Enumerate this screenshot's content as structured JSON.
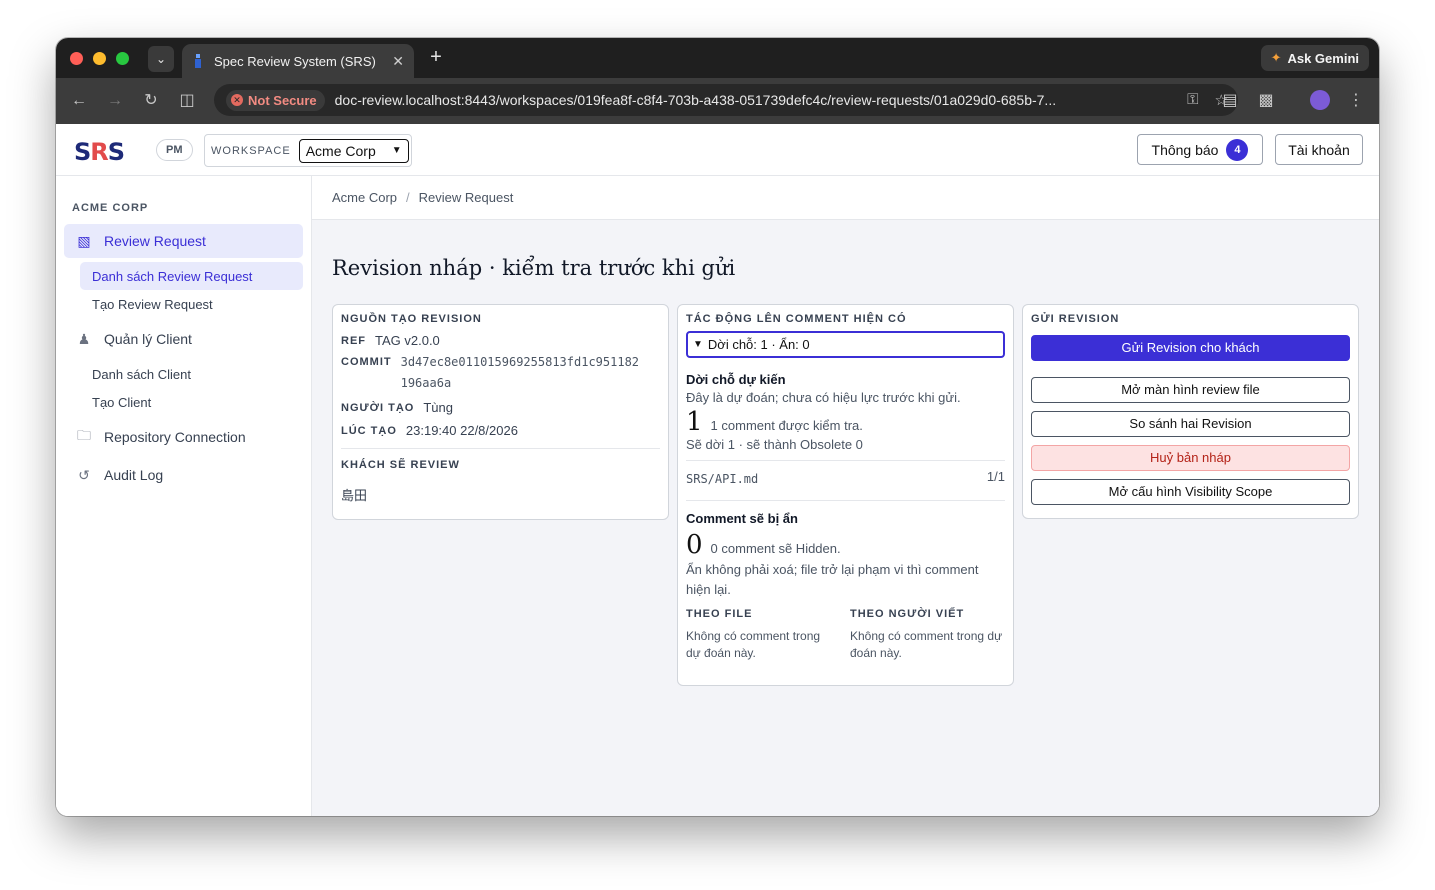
{
  "browser": {
    "tab_title": "Spec Review System (SRS)",
    "not_secure": "Not Secure",
    "url": "doc-review.localhost:8443/workspaces/019fea8f-c8f4-703b-a438-051739defc4c/review-requests/01a029d0-685b-7...",
    "ask_gemini": "Ask Gemini"
  },
  "header": {
    "logo": "SRS",
    "role": "PM",
    "workspace_label": "WORKSPACE",
    "workspace_value": "Acme Corp",
    "notifications_label": "Thông báo",
    "notifications_count": "4",
    "account_label": "Tài khoản"
  },
  "sidebar": {
    "org": "ACME CORP",
    "review_request": "Review Request",
    "review_list": "Danh sách Review Request",
    "review_create": "Tạo Review Request",
    "client_manage": "Quản lý Client",
    "client_list": "Danh sách Client",
    "client_create": "Tạo Client",
    "repo": "Repository Connection",
    "audit": "Audit Log"
  },
  "breadcrumb": {
    "org": "Acme Corp",
    "sep": "/",
    "page": "Review Request"
  },
  "page_title": "Revision nháp · kiểm tra trước khi gửi",
  "source_card": {
    "title": "NGUỒN TẠO REVISION",
    "ref_label": "REF",
    "ref_value": "TAG v2.0.0",
    "commit_label": "COMMIT",
    "commit_line1": "3d47ec8e011015969255813fd1c951182",
    "commit_line2": "196aa6a",
    "creator_label": "NGƯỜI TẠO",
    "creator_value": "Tùng",
    "created_label": "LÚC TẠO",
    "created_value": "23:19:40 22/8/2026",
    "reviewer_title": "KHÁCH SẼ REVIEW",
    "reviewer_value": "島田"
  },
  "impact_card": {
    "title": "TÁC ĐỘNG LÊN COMMENT HIỆN CÓ",
    "summary": "Dời chỗ: 1 · Ẩn: 0",
    "move_title": "Dời chỗ dự kiến",
    "move_note": "Đây là dự đoán; chưa có hiệu lực trước khi gửi.",
    "move_count": "1",
    "move_count_text": "1 comment được kiểm tra.",
    "move_detail": "Sẽ dời 1 · sẽ thành Obsolete 0",
    "file_name": "SRS/API.md",
    "file_ratio": "1/1",
    "hidden_title": "Comment sẽ bị ẩn",
    "hidden_count": "0",
    "hidden_count_text": "0 comment sẽ Hidden.",
    "hidden_note": "Ẩn không phải xoá; file trở lại phạm vi thì comment hiện lại.",
    "by_file_label": "THEO FILE",
    "by_file_text": "Không có comment trong dự đoán này.",
    "by_author_label": "THEO NGƯỜI VIẾT",
    "by_author_text": "Không có comment trong dự đoán này."
  },
  "send_card": {
    "title": "GỬI REVISION",
    "send_btn": "Gửi Revision cho khách",
    "review_btn": "Mở màn hình review file",
    "compare_btn": "So sánh hai Revision",
    "cancel_btn": "Huỷ bản nháp",
    "scope_btn": "Mở cấu hình Visibility Scope"
  },
  "colors": {
    "accent": "#3b2fd6",
    "danger_bg": "#fde2e2",
    "danger_text": "#b42318"
  }
}
